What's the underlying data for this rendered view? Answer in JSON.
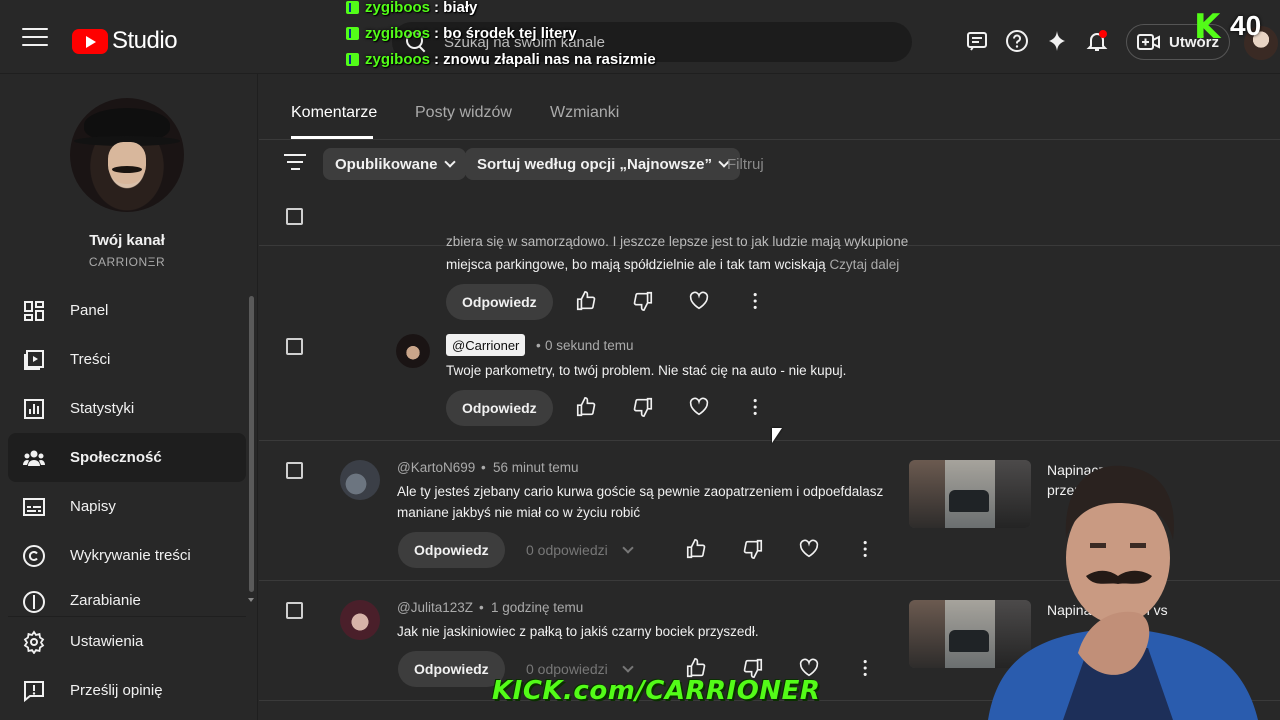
{
  "app": {
    "logo_text": "Studio",
    "search_placeholder": "Szukaj na swoim kanale",
    "create_label": "Utwórz",
    "viewer_count": "40",
    "kick_logo": "K"
  },
  "chat_overlay": [
    {
      "user": "zygiboos",
      "message": ": biały"
    },
    {
      "user": "zygiboos",
      "message": ": bo środek tej litery"
    },
    {
      "user": "zygiboos",
      "message": ": znowu złapali nas na rasizmie"
    }
  ],
  "sidebar": {
    "channel_label": "Twój kanał",
    "channel_name": "CARRIONΞR",
    "items": [
      {
        "label": "Panel",
        "icon": "dashboard-icon"
      },
      {
        "label": "Treści",
        "icon": "content-icon"
      },
      {
        "label": "Statystyki",
        "icon": "analytics-icon"
      },
      {
        "label": "Społeczność",
        "icon": "community-icon",
        "active": true
      },
      {
        "label": "Napisy",
        "icon": "subtitles-icon"
      },
      {
        "label": "Wykrywanie treści",
        "icon": "copyright-icon"
      },
      {
        "label": "Zarabianie",
        "icon": "earn-icon"
      }
    ],
    "bottom_items": [
      {
        "label": "Ustawienia",
        "icon": "settings-icon"
      },
      {
        "label": "Prześlij opinię",
        "icon": "feedback-icon"
      }
    ]
  },
  "tabs": [
    {
      "label": "Komentarze",
      "active": true
    },
    {
      "label": "Posty widzów"
    },
    {
      "label": "Wzmianki"
    }
  ],
  "filters": {
    "published": "Opublikowane",
    "sort": "Sortuj według opcji „Najnowsze”",
    "filter_placeholder": "Filtruj"
  },
  "comments": {
    "partial": {
      "line1": "zbiera się w samorządowo. I jeszcze lepsze jest to jak ludzie mają wykupione",
      "line2": "miejsca parkingowe, bo mają spółdzielnie ale i tak tam wciskają ",
      "read_more": "Czytaj dalej",
      "reply_label": "Odpowiedz"
    },
    "owner_reply": {
      "author": "@Carrioner",
      "time": "0 sekund temu",
      "text": "Twoje parkometry, to twój problem. Nie stać cię na auto - nie kupuj.",
      "reply_label": "Odpowiedz"
    },
    "items": [
      {
        "author": "@KartoN699",
        "time": "56 minut temu",
        "text_line1": "Ale ty jesteś zjebany cario kurwa goście są pewnie zaopatrzeniem i odpoefdalasz",
        "text_line2": "maniane jakbyś nie miał co w życiu robić",
        "reply_label": "Odpowiedz",
        "replies": "0 odpowiedzi",
        "video_title_line1": "Napinacz",
        "video_title_line2": "przepis"
      },
      {
        "author": "@Julita123Z",
        "time": "1 godzinę temu",
        "text_line1": "Jak nie jaskiniowiec z pałką  to jakiś czarny bociek przyszedł.",
        "reply_label": "Odpowiedz",
        "replies": "0 odpowiedzi",
        "video_title_line1": "Napinacz",
        "video_title_line2": "h vs"
      }
    ]
  },
  "overlay": {
    "kick_url": "KICK.com/CARRIONER"
  },
  "colors": {
    "bg": "#282828",
    "kick_green": "#53fc18",
    "youtube_red": "#ff0000"
  }
}
